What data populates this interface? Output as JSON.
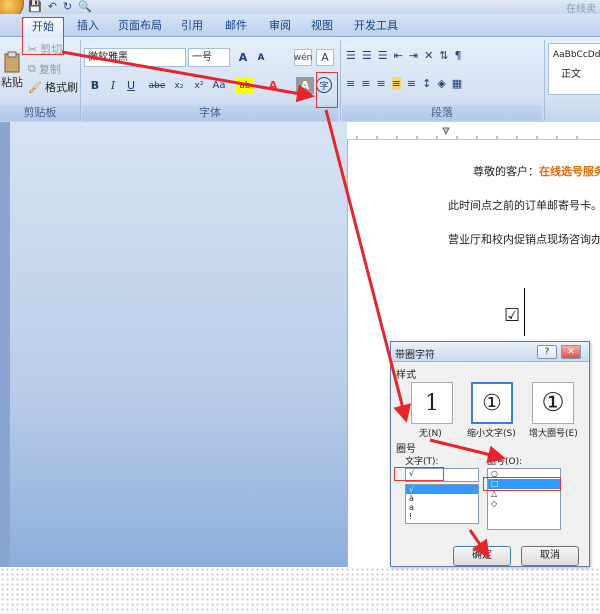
{
  "window": {
    "title": "在线卖"
  },
  "quick_access": {
    "save": "💾",
    "undo": "↶",
    "redo": "↻",
    "preview": "🔍"
  },
  "tabs": [
    {
      "label": "开始"
    },
    {
      "label": "插入"
    },
    {
      "label": "页面布局"
    },
    {
      "label": "引用"
    },
    {
      "label": "邮件"
    },
    {
      "label": "审阅"
    },
    {
      "label": "视图"
    },
    {
      "label": "开发工具"
    }
  ],
  "clipboard": {
    "paste": "粘贴",
    "cut": "剪切",
    "copy": "复制",
    "format_painter": "格式刷",
    "group_label": "剪贴板"
  },
  "font": {
    "family": "微软雅黑",
    "size": "一号",
    "grow": "A",
    "shrink": "A",
    "bold": "B",
    "italic": "I",
    "underline": "U",
    "strike": "abe",
    "subscript": "x₂",
    "superscript": "x²",
    "change_case": "Aa",
    "highlight": "ab",
    "font_color": "A",
    "char_shading": "A",
    "enclose": "字",
    "phonetic": "wén",
    "border": "A",
    "group_label": "字体"
  },
  "paragraph": {
    "group_label": "段落"
  },
  "styles": {
    "sample": "AaBbCcDd",
    "name": "正文"
  },
  "document": {
    "line1_prefix": "尊敬的客户：",
    "line1_highlight": "在线选号服务",
    "line2": "此时间点之前的订单邮寄号卡。",
    "line3": "营业厅和校内促销点现场咨询办",
    "symbol": "☑"
  },
  "dialog": {
    "title": "带圈字符",
    "help": "?",
    "close": "✕",
    "style_label": "样式",
    "styles": [
      {
        "label": "无(N)",
        "glyph": "1"
      },
      {
        "label": "缩小文字(S)",
        "glyph": "①"
      },
      {
        "label": "增大圈号(E)",
        "glyph": "①"
      }
    ],
    "circle_section": "圈号",
    "text_label": "文字(T):",
    "text_value": "√",
    "text_items": [
      "√",
      "à",
      "a",
      "!"
    ],
    "enclosure_label": "圈号(O):",
    "enclosure_items": [
      "○",
      "□",
      "△",
      "◇"
    ],
    "ok": "确定",
    "cancel": "取消"
  },
  "colors": {
    "accent_red": "#e8242a",
    "doc_orange": "#e36c09",
    "selection": "#3399ff"
  }
}
